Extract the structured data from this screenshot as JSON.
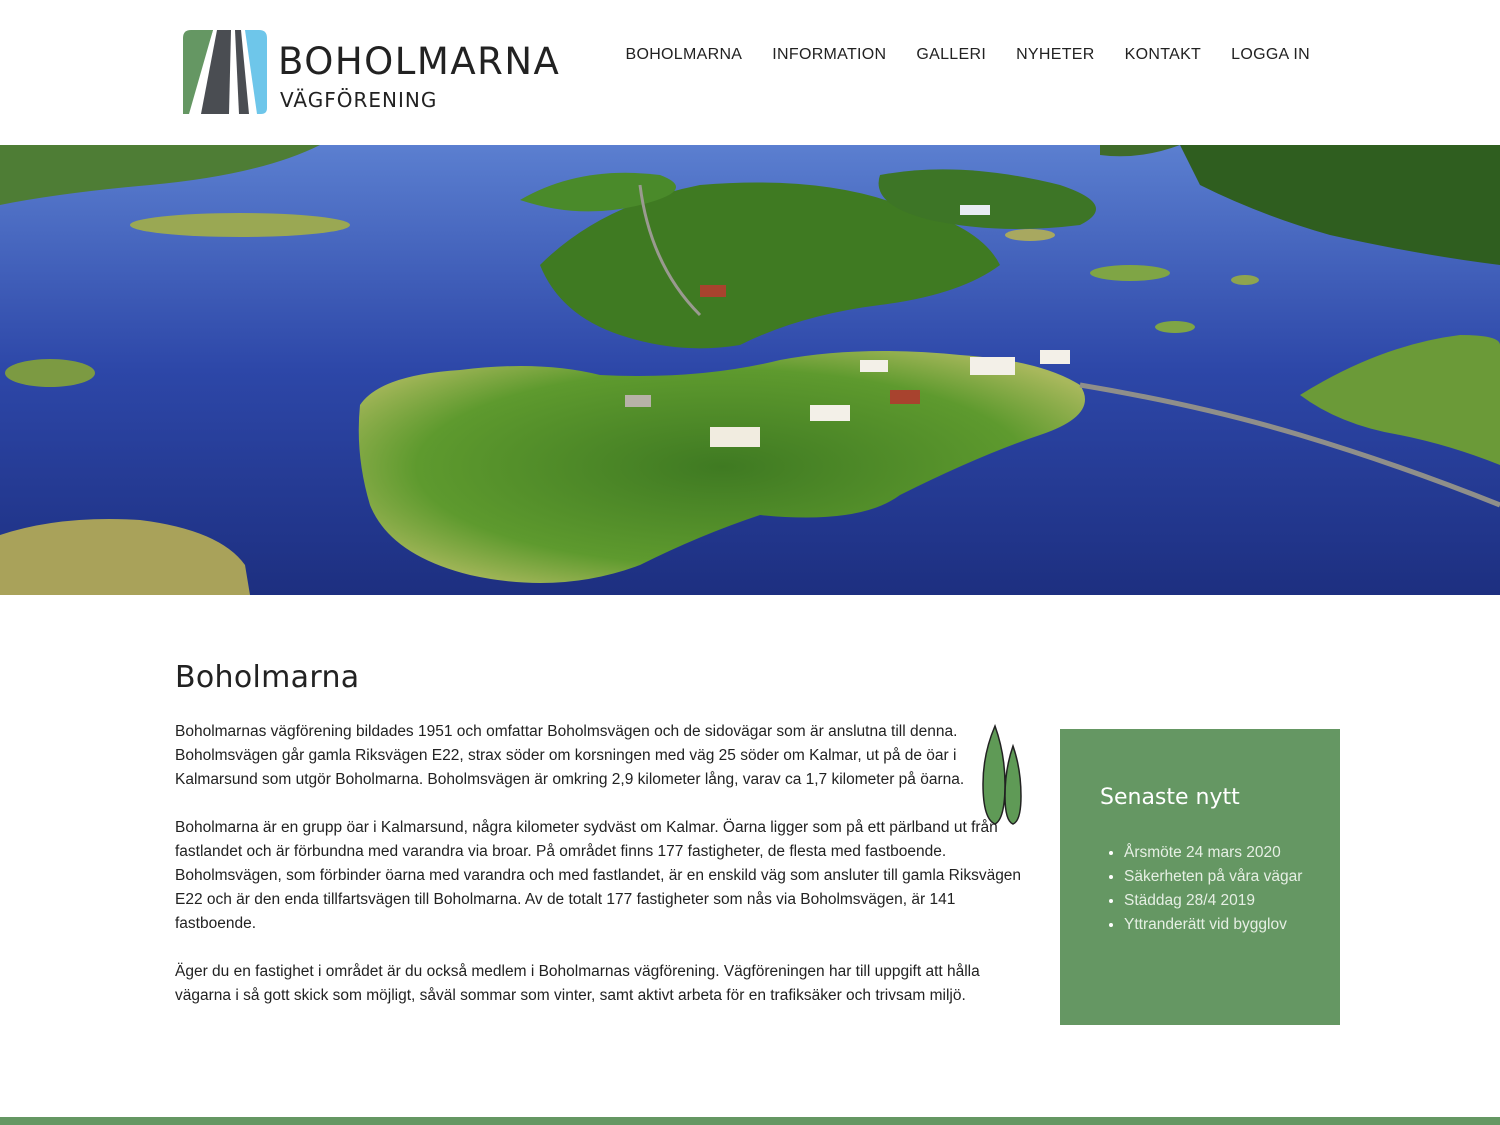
{
  "brand": {
    "title": "BOHOLMARNA",
    "subtitle": "VÄGFÖRENING"
  },
  "nav": {
    "items": [
      "BOHOLMARNA",
      "INFORMATION",
      "GALLERI",
      "NYHETER",
      "KONTAKT",
      "LOGGA IN"
    ]
  },
  "main": {
    "title": "Boholmarna",
    "paragraphs": [
      "Boholmarnas vägförening bildades 1951 och omfattar Boholmsvägen och de sidovägar som är anslutna till denna. Boholmsvägen går gamla Riksvägen E22, strax söder om korsningen med väg 25 söder om Kalmar, ut på de öar i Kalmarsund som utgör Boholmarna. Boholmsvägen är omkring 2,9 kilometer lång, varav ca 1,7 kilometer på öarna.",
      "Boholmarna är en grupp öar i Kalmarsund, några kilometer sydväst om Kalmar. Öarna ligger som på ett pärlband ut från fastlandet och är förbundna med varandra via broar. På området finns 177 fastigheter, de flesta med fastboende. Boholmsvägen, som förbinder öarna med varandra och med fastlandet, är en enskild väg som ansluter till gamla Riksvägen E22 och är den enda tillfartsvägen till Boholmarna. Av de totalt 177 fastigheter som nås via Boholmsvägen, är 141 fastboende.",
      "Äger du en fastighet i området är du också medlem i Boholmarnas vägförening. Vägföreningen har till uppgift att hålla vägarna i så gott skick som möjligt, såväl sommar som vinter, samt aktivt arbeta för en trafiksäker och trivsam miljö."
    ]
  },
  "sidebar": {
    "title": "Senaste nytt",
    "items": [
      "Årsmöte 24 mars 2020",
      "Säkerheten på våra vägar",
      "Städdag 28/4 2019",
      "Yttranderätt vid bygglov"
    ]
  },
  "colors": {
    "accent_green": "#659763",
    "logo_blue": "#6ec6ea",
    "logo_dark": "#4a4d52"
  },
  "icons": [
    "logo-road-icon",
    "cypress-tree-icon"
  ]
}
